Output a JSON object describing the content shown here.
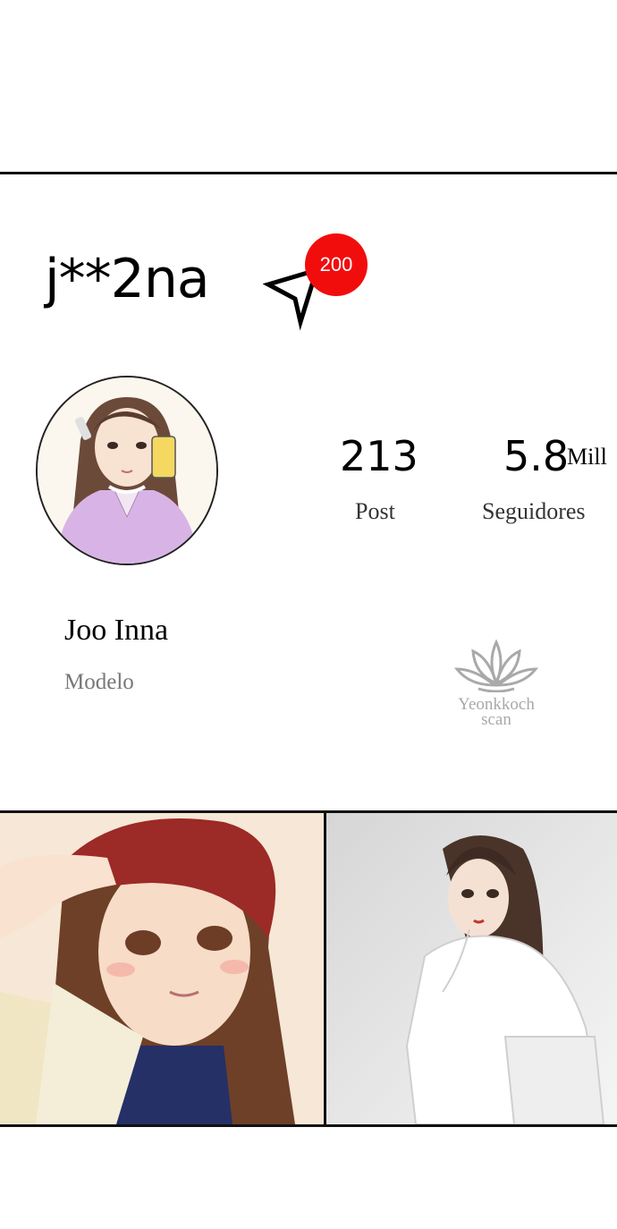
{
  "profile": {
    "username": "j**2na",
    "notification_count": "200",
    "display_name": "Joo Inna",
    "bio": "Modelo"
  },
  "stats": {
    "posts_value": "213",
    "posts_label": "Post",
    "followers_value": "5.8",
    "followers_unit": "Mill",
    "followers_label": "Seguidores"
  },
  "watermark": {
    "line1": "Yeonkkoch",
    "line2": "scan"
  },
  "colors": {
    "badge": "#f20d0d",
    "background": "#ffffff",
    "muted_text": "#777777"
  },
  "icons": {
    "direct_message": "send-arrow-icon",
    "watermark_logo": "lotus-icon"
  }
}
